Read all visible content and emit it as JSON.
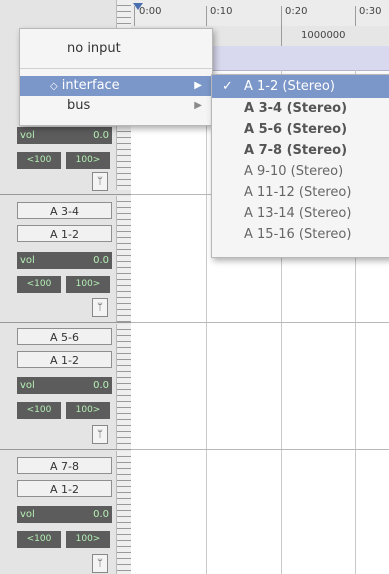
{
  "timeline": {
    "ticks": [
      "0:00",
      "0:10",
      "0:20",
      "0:30"
    ],
    "bar_value": "1000000"
  },
  "main_menu": {
    "no_input": "no input",
    "interface": "interface",
    "bus": "bus",
    "interface_bullet": "◇",
    "submenu_arrow": "▶"
  },
  "submenu": {
    "checkmark": "✓",
    "items": [
      "A 1-2 (Stereo)",
      "A 3-4 (Stereo)",
      "A 5-6 (Stereo)",
      "A 7-8 (Stereo)",
      "A 9-10 (Stereo)",
      "A 11-12 (Stereo)",
      "A 13-14 (Stereo)",
      "A 15-16 (Stereo)"
    ]
  },
  "tracks": [
    {
      "vol_label": "vol",
      "vol_value": "0.0",
      "pan_left": "<100",
      "pan_right": "100>"
    },
    {
      "input": "A 3-4",
      "output": "A 1-2",
      "vol_label": "vol",
      "vol_value": "0.0",
      "pan_left": "<100",
      "pan_right": "100>"
    },
    {
      "input": "A 5-6",
      "output": "A 1-2",
      "vol_label": "vol",
      "vol_value": "0.0",
      "pan_left": "<100",
      "pan_right": "100>"
    },
    {
      "input": "A 7-8",
      "output": "A 1-2",
      "vol_label": "vol",
      "vol_value": "0.0",
      "pan_left": "<100",
      "pan_right": "100>"
    }
  ],
  "icons": {
    "fader": "fader-icon"
  }
}
